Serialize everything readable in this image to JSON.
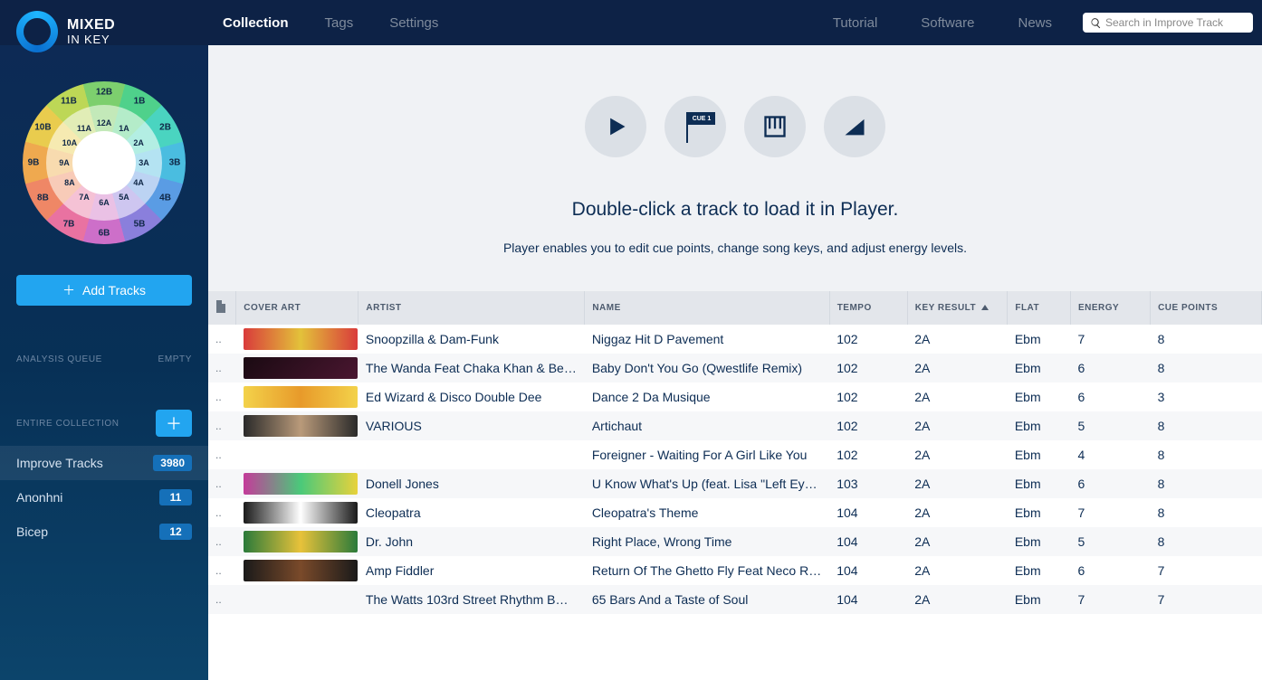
{
  "app": {
    "name_line1": "MIXED",
    "name_line2": "IN KEY"
  },
  "nav": {
    "collection": "Collection",
    "tags": "Tags",
    "settings": "Settings"
  },
  "links": {
    "tutorial": "Tutorial",
    "software": "Software",
    "news": "News"
  },
  "search": {
    "placeholder": "Search in Improve Track"
  },
  "sidebar": {
    "add_tracks": "Add Tracks",
    "queue_label": "ANALYSIS QUEUE",
    "queue_status": "EMPTY",
    "entire_collection": "ENTIRE COLLECTION",
    "playlists": [
      {
        "name": "Improve Tracks",
        "count": "3980",
        "active": true
      },
      {
        "name": "Anonhni",
        "count": "11",
        "active": false
      },
      {
        "name": "Bicep",
        "count": "12",
        "active": false
      }
    ]
  },
  "camelot": {
    "outer": [
      "12B",
      "1B",
      "2B",
      "3B",
      "4B",
      "5B",
      "6B",
      "7B",
      "8B",
      "9B",
      "10B",
      "11B"
    ],
    "inner": [
      "12A",
      "1A",
      "2A",
      "3A",
      "4A",
      "5A",
      "6A",
      "7A",
      "8A",
      "9A",
      "10A",
      "11A"
    ]
  },
  "player": {
    "cue_label": "CUE 1",
    "title": "Double-click a track to load it in Player.",
    "subtitle": "Player enables you to edit cue points, change song keys, and adjust energy levels."
  },
  "table": {
    "headers": {
      "ext": "",
      "cover": "COVER ART",
      "artist": "ARTIST",
      "name": "NAME",
      "tempo": "TEMPO",
      "key": "KEY RESULT",
      "flat": "FLAT",
      "energy": "ENERGY",
      "cue": "CUE POINTS"
    },
    "sorted_col": "key",
    "rows": [
      {
        "artist": "Snoopzilla & Dam-Funk",
        "name": "Niggaz Hit D Pavement",
        "tempo": "102",
        "key": "2A",
        "flat": "Ebm",
        "energy": "7",
        "cue": "8",
        "cover_css": "linear-gradient(90deg,#d93b3b,#e3c23a,#d93b3b)"
      },
      {
        "artist": "The Wanda Feat Chaka Khan & Be…",
        "name": "Baby Don't You Go (Qwestlife Remix)",
        "tempo": "102",
        "key": "2A",
        "flat": "Ebm",
        "energy": "6",
        "cue": "8",
        "cover_css": "linear-gradient(135deg,#1a0a12,#4a1630)"
      },
      {
        "artist": "Ed Wizard & Disco Double Dee",
        "name": "Dance 2 Da Musique",
        "tempo": "102",
        "key": "2A",
        "flat": "Ebm",
        "energy": "6",
        "cue": "3",
        "cover_css": "linear-gradient(90deg,#f3d24a,#e89a2a,#f3d24a)"
      },
      {
        "artist": "VARIOUS",
        "name": "Artichaut",
        "tempo": "102",
        "key": "2A",
        "flat": "Ebm",
        "energy": "5",
        "cue": "8",
        "cover_css": "linear-gradient(90deg,#2a2a2a,#b99a7a,#2a2a2a)"
      },
      {
        "artist": "",
        "name": "Foreigner - Waiting For A Girl Like You",
        "tempo": "102",
        "key": "2A",
        "flat": "Ebm",
        "energy": "4",
        "cue": "8",
        "cover_css": "",
        "no_cover": true
      },
      {
        "artist": "Donell Jones",
        "name": "U Know What's Up (feat. Lisa \"Left Eye\"…",
        "tempo": "103",
        "key": "2A",
        "flat": "Ebm",
        "energy": "6",
        "cue": "8",
        "cover_css": "linear-gradient(90deg,#c43b9a,#4ac97a,#e8d23b)"
      },
      {
        "artist": "Cleopatra",
        "name": "Cleopatra's Theme",
        "tempo": "104",
        "key": "2A",
        "flat": "Ebm",
        "energy": "7",
        "cue": "8",
        "cover_css": "linear-gradient(90deg,#1a1a1a,#fff,#1a1a1a)"
      },
      {
        "artist": "Dr. John",
        "name": "Right Place, Wrong Time",
        "tempo": "104",
        "key": "2A",
        "flat": "Ebm",
        "energy": "5",
        "cue": "8",
        "cover_css": "linear-gradient(90deg,#2a7a3a,#e8c23a,#2a7a3a)"
      },
      {
        "artist": "Amp Fiddler",
        "name": "Return Of The Ghetto Fly Feat Neco Re…",
        "tempo": "104",
        "key": "2A",
        "flat": "Ebm",
        "energy": "6",
        "cue": "7",
        "cover_css": "linear-gradient(90deg,#1a1a1a,#7a4a2a,#1a1a1a)"
      },
      {
        "artist": "The Watts 103rd Street Rhythm B…",
        "name": "65 Bars And a Taste of Soul",
        "tempo": "104",
        "key": "2A",
        "flat": "Ebm",
        "energy": "7",
        "cue": "7",
        "cover_css": "",
        "no_cover": true
      }
    ]
  }
}
